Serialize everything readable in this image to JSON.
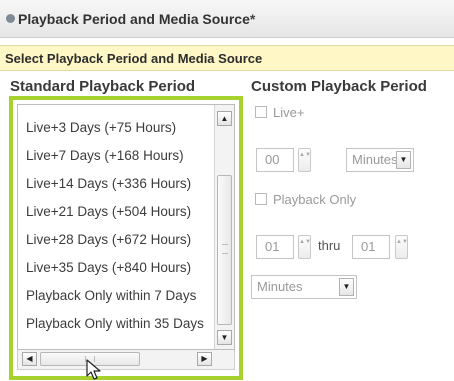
{
  "panel": {
    "title": "Playback Period and Media Source",
    "required_marker": "*",
    "subheader": "Select Playback Period and Media Source"
  },
  "standard": {
    "heading": "Standard Playback Period",
    "items": [
      "Live+3 Days (+75 Hours)",
      "Live+7 Days (+168 Hours)",
      "Live+14 Days (+336 Hours)",
      "Live+21 Days (+504 Hours)",
      "Live+28 Days (+672 Hours)",
      "Live+35 Days (+840 Hours)",
      "Playback Only within 7 Days",
      "Playback Only within 35 Days"
    ],
    "focus_color": "#a6d12e"
  },
  "custom": {
    "heading": "Custom Playback Period",
    "live_plus_label": "Live+",
    "live_value": "00",
    "live_unit": "Minutes",
    "playback_only_label": "Playback Only",
    "range_from": "01",
    "thru_label": "thru",
    "range_to": "01",
    "range_unit": "Minutes"
  },
  "icons": {
    "scroll_up": "▲",
    "scroll_down": "▼",
    "scroll_left": "◀",
    "scroll_right": "▶",
    "spin": "▲▼",
    "dropdown": "▼"
  }
}
